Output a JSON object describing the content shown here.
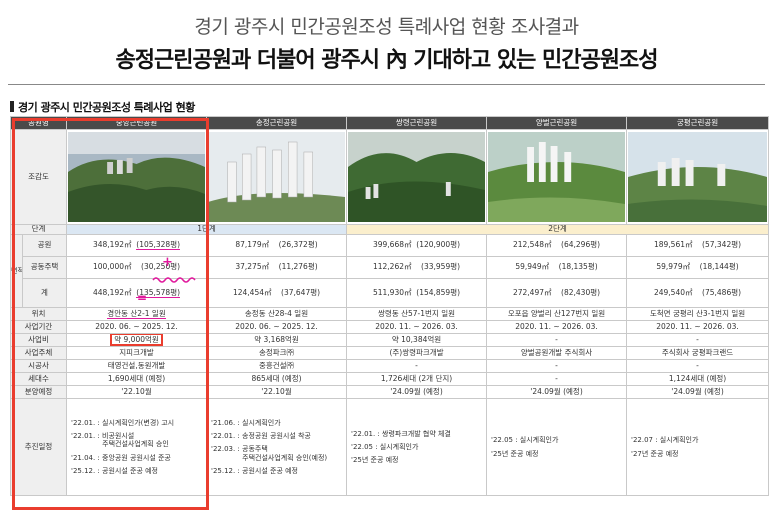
{
  "header": {
    "title": "경기 광주시 민간공원조성 특례사업 현황 조사결과",
    "subtitle": "송정근린공원과 더불어 광주시 內 기대하고 있는 민간공원조성"
  },
  "section_title": "경기 광주시 민간공원조성 특례사업 현황",
  "table": {
    "corner": "공원명",
    "parks": [
      "중앙근린공원",
      "송정근린공원",
      "쌍령근린공원",
      "양벌근린공원",
      "궁평근린공원"
    ],
    "row_labels": {
      "view": "조감도",
      "stage": "단계",
      "area_group": "면적",
      "park": "공원",
      "housing": "공동주택",
      "total": "계",
      "location": "위치",
      "period": "사업기간",
      "cost": "사업비",
      "owner": "사업주체",
      "builder": "시공사",
      "households": "세대수",
      "sale": "분양예정",
      "progress": "추진일정"
    },
    "stage1": "1단계",
    "stage2": "2단계",
    "park_area": [
      [
        "348,192㎡",
        "(105,328평)"
      ],
      [
        "87,179㎡",
        "(26,372평)"
      ],
      [
        "399,668㎡",
        "(120,900평)"
      ],
      [
        "212,548㎡",
        "(64,296평)"
      ],
      [
        "189,561㎡",
        "(57,342평)"
      ]
    ],
    "housing_area": [
      [
        "100,000㎡",
        "(30,250평)"
      ],
      [
        "37,275㎡",
        "(11,276평)"
      ],
      [
        "112,262㎡",
        "(33,959평)"
      ],
      [
        "59,949㎡",
        "(18,135평)"
      ],
      [
        "59,979㎡",
        "(18,144평)"
      ]
    ],
    "total_area": [
      [
        "448,192㎡",
        "(135,578평)"
      ],
      [
        "124,454㎡",
        "(37,647평)"
      ],
      [
        "511,930㎡",
        "(154,859평)"
      ],
      [
        "272,497㎡",
        "(82,430평)"
      ],
      [
        "249,540㎡",
        "(75,486평)"
      ]
    ],
    "location": [
      "경안동 산2-1 일원",
      "송정동 산28-4 일원",
      "쌍령동 산57-1번지 일원",
      "오포읍 양벌리 산127번지 일원",
      "도척면 궁평리 산3-1번지 일원"
    ],
    "period": [
      "2020. 06. ~ 2025. 12.",
      "2020. 06. ~ 2025. 12.",
      "2020. 11. ~ 2026. 03.",
      "2020. 11. ~ 2026. 03.",
      "2020. 11. ~ 2026. 03."
    ],
    "cost": [
      "약 9,000억원",
      "약 3,168억원",
      "약 10,384억원",
      "-",
      "-"
    ],
    "owner": [
      "지피크개발",
      "송정파크㈜",
      "(주)쌍령파크개발",
      "양벌공원개발 주식회사",
      "주식회사 궁평파크랜드"
    ],
    "builder": [
      "태영건설,동원개발",
      "중흥건설㈜",
      "-",
      "-",
      "-"
    ],
    "households": [
      "1,690세대 (예정)",
      "865세대 (예정)",
      "1,726세대 (2개 단지)",
      "-",
      "1,124세대 (예정)"
    ],
    "sale": [
      "'22.10월",
      "'22.10월",
      "'24.09월 (예정)",
      "'24.09월 (예정)",
      "'24.09월 (예정)"
    ],
    "progress": [
      [
        "'22.01. : 실시계획인가(변경) 고시",
        "'22.01. : 비공원시설\n              주택건설사업계획 승인",
        "'21.04. : 중앙공원 공원시설 준공",
        "'25.12. : 공원시설 준공 예정"
      ],
      [
        "'21.06. : 실시계획인가",
        "'22.01. : 송정공원 공원시설 착공",
        "'22.03. : 공동주택\n              주택건설사업계획 승인(예정)",
        "'25.12. : 공원시설 준공 예정"
      ],
      [
        "'22.01. : 쌍령파크개발 협약 체결",
        "'22.05 : 실시계획인가",
        "'25년 준공 예정"
      ],
      [
        "'22.05 : 실시계획인가",
        "'25년 준공 예정"
      ],
      [
        "'22.07 : 실시계획인가",
        "'27년 준공 예정"
      ]
    ]
  },
  "annotations": {
    "plus": "+",
    "equals": "="
  },
  "colors": {
    "highlight_red": "#ea3d2e",
    "marker_magenta": "#e0199c",
    "header_dark": "#4a4a4a",
    "stage1_bg": "#dbe7f3",
    "stage2_bg": "#fbefcd"
  }
}
